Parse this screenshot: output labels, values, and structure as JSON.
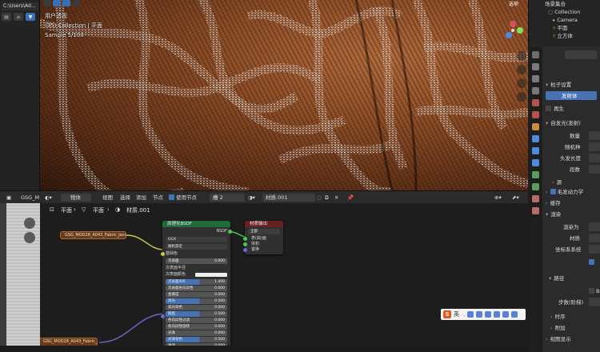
{
  "file_browser": {
    "path": "C:\\Users\\Ad..."
  },
  "viewport": {
    "mode_label": "用户透视",
    "collection_line": "(35) Collection | 平面",
    "sample_line": "Sample 5/100",
    "top_right_label": "选项"
  },
  "outliner": {
    "title": "场景集合",
    "items": [
      {
        "label": "Collection"
      },
      {
        "label": "Camera"
      },
      {
        "label": "平面"
      },
      {
        "label": "立方体"
      }
    ]
  },
  "properties": {
    "particle_settings": "粒子设置",
    "emitter": "发射体",
    "regrow": "再生",
    "emission_panel": "自发光(发射)",
    "number_label": "数量",
    "seed_label": "随机种",
    "hair_length": "头发长度",
    "segments": "段数",
    "source": "源",
    "hair_dynamics": "毛发动力学",
    "cache": "缓存",
    "render": "渲染",
    "render_as": "渲染为",
    "material": "材质",
    "coordinate_system": "坐标系系统",
    "path": "路径",
    "b_spline": "B-",
    "steps": "步数(阶梯)",
    "timing": "时序",
    "extra": "附加",
    "viewport_display": "视图显示"
  },
  "node_header": {
    "editor_left": "GSG_M",
    "object_label": "物体",
    "menu_view": "视图",
    "menu_select": "选择",
    "menu_add": "添加",
    "menu_node": "节点",
    "use_nodes": "使用节点",
    "slot": "槽 2",
    "material": "材质.001"
  },
  "breadcrumb": {
    "first": "平面",
    "second": "平面",
    "third": "材质.001"
  },
  "nodes": {
    "image_node_top": "GSG_MOD28_A043_Fabric_Jacquard_BS",
    "image_node_bottom": "GSG_MOD28_A043_Fabric_Jacquard_N",
    "principled": {
      "title": "原理化BSDF",
      "output": "BSDF",
      "distribution": "GGX",
      "subsurface_method": "随机游走",
      "rows": [
        {
          "label": "基础色",
          "value": ""
        },
        {
          "label": "次表面",
          "value": "0.000"
        },
        {
          "label": "次表面半径",
          "value": ""
        },
        {
          "label": "次表面颜色",
          "value": ""
        },
        {
          "label": "次表面IOR",
          "value": "1.400"
        },
        {
          "label": "次表面各向异性",
          "value": "0.000"
        },
        {
          "label": "金属度",
          "value": "0.000"
        },
        {
          "label": "高光",
          "value": "0.500"
        },
        {
          "label": "高光染色",
          "value": "0.000"
        },
        {
          "label": "糙度",
          "value": "0.500"
        },
        {
          "label": "各向异性过滤",
          "value": "0.000"
        },
        {
          "label": "各向异性旋转",
          "value": "0.000"
        },
        {
          "label": "光泽",
          "value": "0.000"
        },
        {
          "label": "光泽染色",
          "value": "0.500"
        },
        {
          "label": "清漆",
          "value": "0.000"
        }
      ]
    },
    "material_output": {
      "title": "材质输出",
      "target": "全部",
      "sockets": [
        "表(曲)面",
        "体积",
        "置换"
      ]
    }
  },
  "ime": {
    "logo": "S",
    "lang": "英"
  },
  "colors": {
    "accent": "#4772b3",
    "shader_header": "#1f6b3a",
    "output_header": "#6a1f22",
    "image_node": "#6b3a1a"
  }
}
